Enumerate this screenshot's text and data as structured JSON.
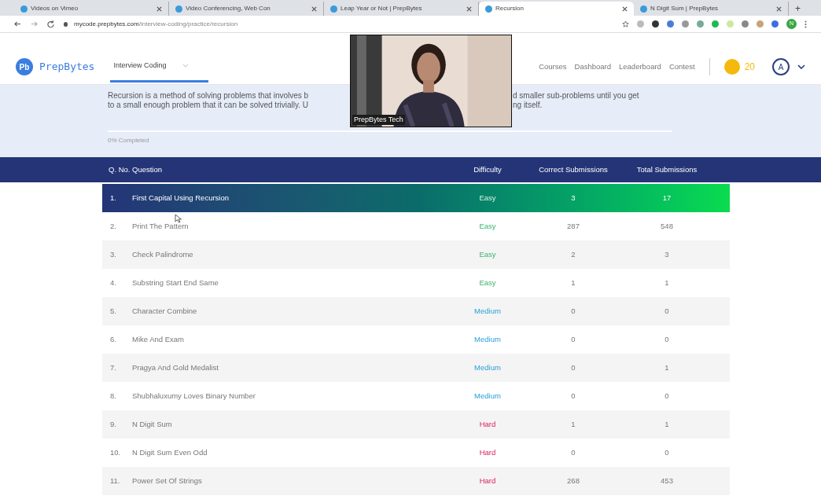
{
  "browser": {
    "tabs": [
      {
        "title": "Videos on Vimeo",
        "selected": false
      },
      {
        "title": "Video Conferencing, Web Con",
        "selected": false
      },
      {
        "title": "Leap Year or Not | PrepBytes",
        "selected": false
      },
      {
        "title": "Recursion",
        "selected": true
      },
      {
        "title": "N Digit Sum | PrepBytes",
        "selected": false
      }
    ],
    "new_tab": "+",
    "url_host": "mycode.prepbytes.com",
    "url_path": "/interview-coding/practice/recursion",
    "profile": "N"
  },
  "header": {
    "logo": "PrepBytes",
    "logo_mark": "Pb",
    "section": "Interview Coding",
    "nav": [
      "Courses",
      "Dashboard",
      "Leaderboard",
      "Contest"
    ],
    "coins": "20",
    "avatar": "A"
  },
  "intro": {
    "lines": [
      {
        "left": "Recursion is a method of solving problems that involves b",
        "right": "d smaller sub-problems until you get"
      },
      {
        "left": "to a small enough problem that it can be solved trivially. U",
        "right": "ng itself."
      }
    ],
    "progress": {
      "level": 0,
      "label": "0% Completed"
    }
  },
  "video": {
    "caption": "PrepBytes Tech"
  },
  "table": {
    "columns": [
      "Q. No.",
      "Question",
      "Difficulty",
      "Correct Submissions",
      "Total Submissions"
    ],
    "rows": [
      {
        "no": "1.",
        "question": "First Capital Using Recursion",
        "difficulty": "Easy",
        "kind": "easy",
        "correct": "3",
        "total": "17",
        "selected": true
      },
      {
        "no": "2.",
        "question": "Print The Pattern",
        "difficulty": "Easy",
        "kind": "easy",
        "correct": "287",
        "total": "548",
        "selected": false
      },
      {
        "no": "3.",
        "question": "Check Palindrome",
        "difficulty": "Easy",
        "kind": "easy",
        "correct": "2",
        "total": "3",
        "selected": false
      },
      {
        "no": "4.",
        "question": "Substring Start End Same",
        "difficulty": "Easy",
        "kind": "easy",
        "correct": "1",
        "total": "1",
        "selected": false
      },
      {
        "no": "5.",
        "question": "Character Combine",
        "difficulty": "Medium",
        "kind": "medium",
        "correct": "0",
        "total": "0",
        "selected": false
      },
      {
        "no": "6.",
        "question": "Mike And Exam",
        "difficulty": "Medium",
        "kind": "medium",
        "correct": "0",
        "total": "0",
        "selected": false
      },
      {
        "no": "7.",
        "question": "Pragya And Gold Medalist",
        "difficulty": "Medium",
        "kind": "medium",
        "correct": "0",
        "total": "1",
        "selected": false
      },
      {
        "no": "8.",
        "question": "Shubhaluxumy Loves Binary Number",
        "difficulty": "Medium",
        "kind": "medium",
        "correct": "0",
        "total": "0",
        "selected": false
      },
      {
        "no": "9.",
        "question": "N Digit Sum",
        "difficulty": "Hard",
        "kind": "hard",
        "correct": "1",
        "total": "1",
        "selected": false
      },
      {
        "no": "10.",
        "question": "N Digit Sum Even Odd",
        "difficulty": "Hard",
        "kind": "hard",
        "correct": "0",
        "total": "0",
        "selected": false
      },
      {
        "no": "11.",
        "question": "Power Set Of Strings",
        "difficulty": "Hard",
        "kind": "hard",
        "correct": "268",
        "total": "453",
        "selected": false
      }
    ]
  }
}
